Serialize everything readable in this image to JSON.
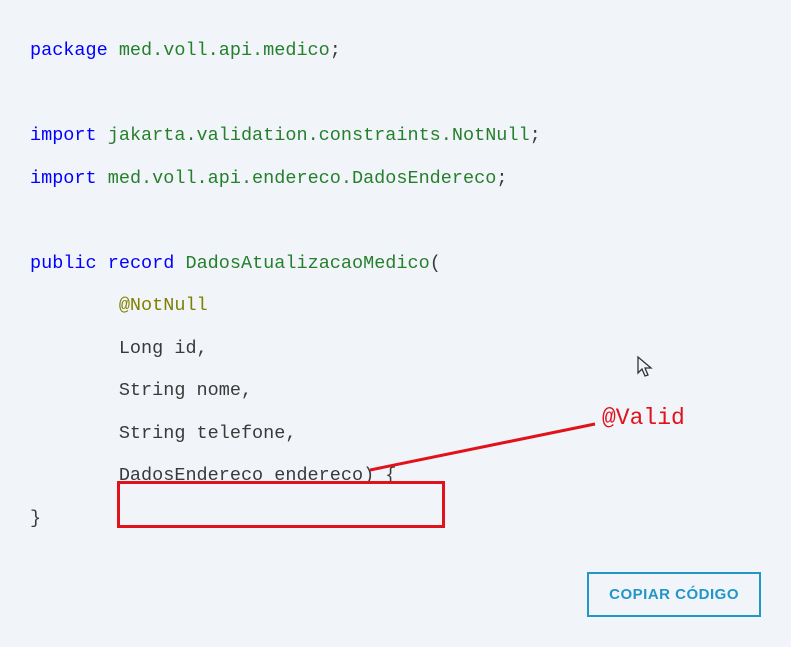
{
  "code": {
    "line1_kw": "package",
    "line1_pkg": "med.voll.api.medico",
    "line1_semi": ";",
    "line3_kw": "import",
    "line3_pkg": "jakarta.validation.constraints.NotNull",
    "line3_semi": ";",
    "line4_kw": "import",
    "line4_pkg": "med.voll.api.endereco.DadosEndereco",
    "line4_semi": ";",
    "line6_kw1": "public",
    "line6_kw2": "record",
    "line6_name": "DadosAtualizacaoMedico",
    "line6_paren": "(",
    "line7_annot": "@NotNull",
    "line8": "Long id,",
    "line9": "String nome,",
    "line10": "String telefone,",
    "line11": "DadosEndereco endereco) {",
    "line12": "}"
  },
  "annotation": {
    "valid_label": "@Valid"
  },
  "button": {
    "copy_label": "COPIAR CÓDIGO"
  }
}
